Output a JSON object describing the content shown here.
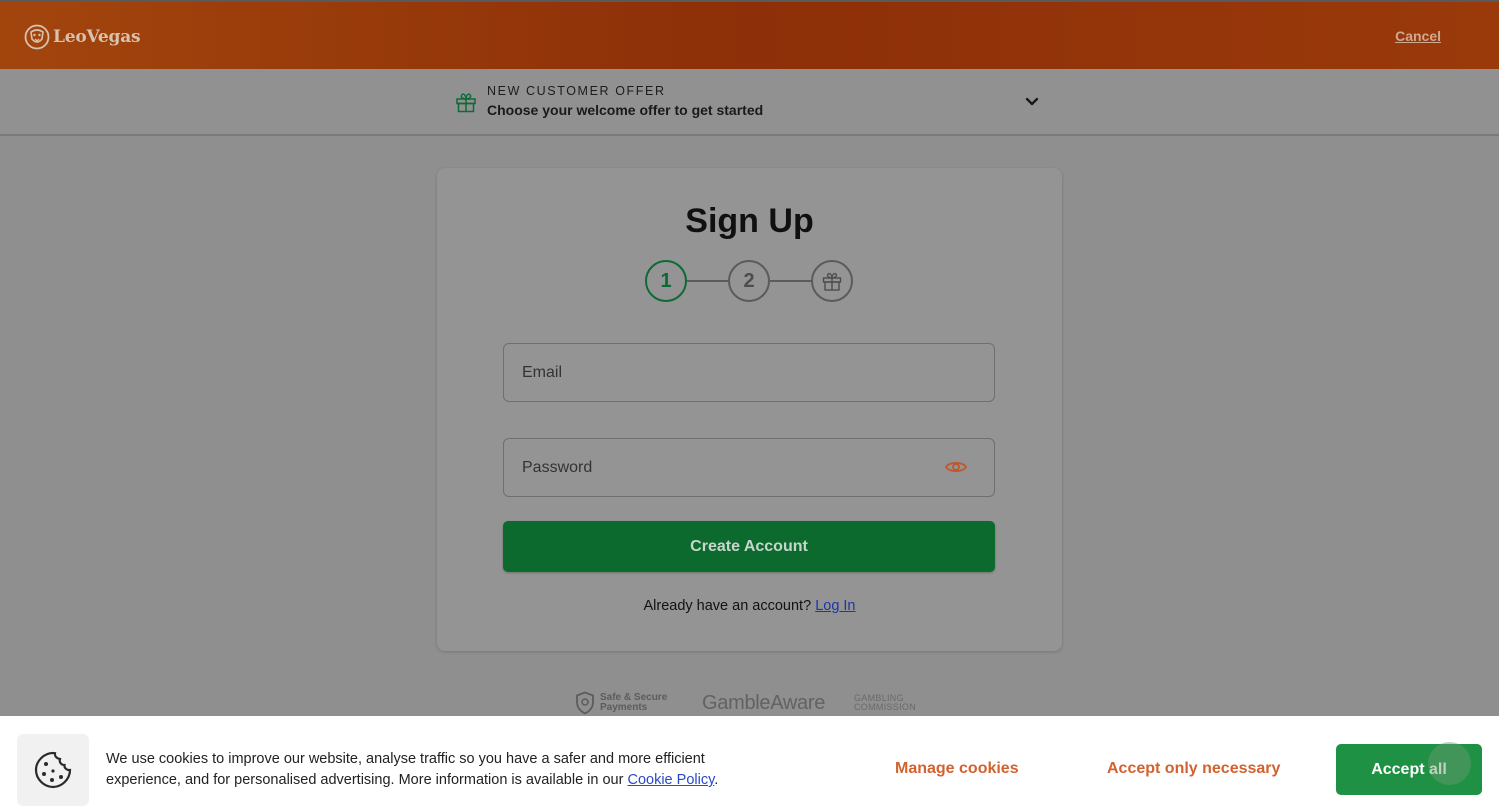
{
  "header": {
    "logo_text": "LeoVegas",
    "logo_icon": "lion-head-icon",
    "cancel_label": "Cancel"
  },
  "offer": {
    "icon": "gift-icon",
    "kicker": "NEW CUSTOMER OFFER",
    "title": "Choose your welcome offer to get started",
    "expand_icon": "chevron-down-icon"
  },
  "signup": {
    "title": "Sign Up",
    "steps": [
      {
        "label": "1",
        "state": "active"
      },
      {
        "label": "2",
        "state": "inactive"
      },
      {
        "label": "",
        "icon": "gift-icon",
        "state": "inactive"
      }
    ],
    "email_placeholder": "Email",
    "email_value": "",
    "password_placeholder": "Password",
    "password_value": "",
    "password_toggle_icon": "eye-icon",
    "create_button": "Create Account",
    "login_prompt": "Already have an account?",
    "login_link": "Log In"
  },
  "trust": {
    "secure_line1": "Safe & Secure",
    "secure_line2": "Payments",
    "gambleaware": "GambleAware",
    "gc_line1": "GAMBLING",
    "gc_line2": "COMMISSION"
  },
  "cookie": {
    "icon": "cookie-icon",
    "text_line1": "We use cookies to improve our website, analyse traffic so you have a safer and more efficient",
    "text_line2": "experience, and for personalised advertising. More information is available in our",
    "policy_link": "Cookie Policy",
    "text_end": ".",
    "manage_label": "Manage cookies",
    "necessary_label": "Accept only necessary",
    "accept_label": "Accept all"
  },
  "colors": {
    "header_orange": "#8d2f08",
    "primary_green": "#0d6a2f",
    "accept_green": "#1e9145",
    "cookie_orange": "#d2622f",
    "link_blue": "#2a49c8"
  }
}
